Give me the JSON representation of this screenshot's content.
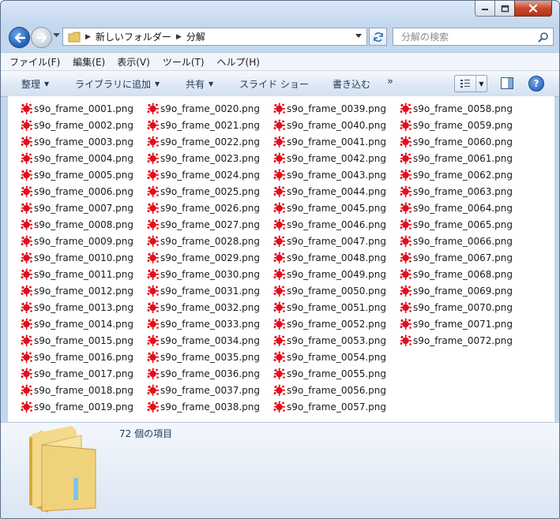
{
  "window": {
    "accent": "#1c57b0",
    "close_color": "#c6472d"
  },
  "title_controls": [
    "minimize-icon",
    "maximize-icon",
    "close-icon"
  ],
  "address": {
    "segments": [
      "新しいフォルダー",
      "分解"
    ]
  },
  "search": {
    "placeholder": "分解の検索"
  },
  "menu": [
    "ファイル(F)",
    "編集(E)",
    "表示(V)",
    "ツール(T)",
    "ヘルプ(H)"
  ],
  "toolbar": {
    "organize": "整理",
    "library": "ライブラリに追加",
    "share": "共有",
    "slideshow": "スライド ショー",
    "burn": "書き込む",
    "more": "»"
  },
  "files": {
    "prefix": "s9o_frame_",
    "extension": ".png",
    "first": 1,
    "count": 72,
    "icon": "png-image-icon"
  },
  "details": {
    "item_count": "72 個の項目",
    "icon": "folder-icon"
  }
}
